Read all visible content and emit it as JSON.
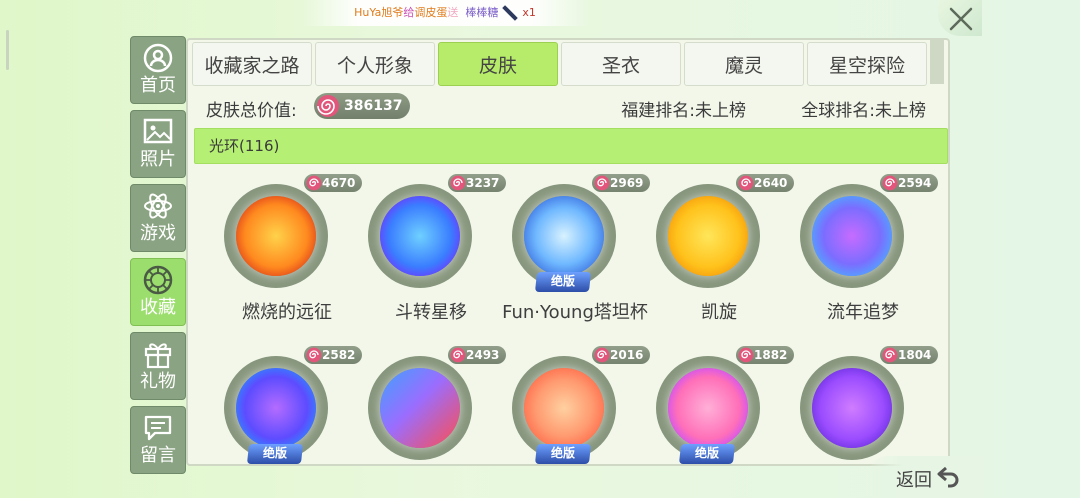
{
  "notice": {
    "part1": "HuYa旭爷",
    "part2": "给",
    "part3": "调皮蛋",
    "part4": "送",
    "part5": "棒棒糖",
    "count": "x1"
  },
  "sidebar": {
    "items": [
      {
        "label": "首页",
        "icon": "user-icon"
      },
      {
        "label": "照片",
        "icon": "photo-icon"
      },
      {
        "label": "游戏",
        "icon": "atom-icon"
      },
      {
        "label": "收藏",
        "icon": "collection-icon"
      },
      {
        "label": "礼物",
        "icon": "gift-icon"
      },
      {
        "label": "留言",
        "icon": "message-icon"
      }
    ],
    "active_index": 3
  },
  "tabs": [
    "收藏家之路",
    "个人形象",
    "皮肤",
    "圣衣",
    "魔灵",
    "星空探险"
  ],
  "active_tab": "皮肤",
  "value_row": {
    "label": "皮肤总价值:",
    "value": "386137",
    "rank_province": "福建排名:未上榜",
    "rank_global": "全球排名:未上榜"
  },
  "section": {
    "title": "光环(116)"
  },
  "items": [
    {
      "name": "燃烧的远征",
      "price": "4670",
      "limited": false
    },
    {
      "name": "斗转星移",
      "price": "3237",
      "limited": false
    },
    {
      "name": "Fun·Young塔坦杯",
      "price": "2969",
      "limited": true
    },
    {
      "name": "凯旋",
      "price": "2640",
      "limited": false
    },
    {
      "name": "流年追梦",
      "price": "2594",
      "limited": false
    },
    {
      "name": "",
      "price": "2582",
      "limited": true
    },
    {
      "name": "",
      "price": "2493",
      "limited": false
    },
    {
      "name": "",
      "price": "2016",
      "limited": true
    },
    {
      "name": "",
      "price": "1882",
      "limited": true
    },
    {
      "name": "",
      "price": "1804",
      "limited": false
    }
  ],
  "limited_label": "绝版",
  "back_label": "返回",
  "colors": {
    "accent": "#b7ec6a",
    "nav": "#8aa382",
    "nav_active": "#9cde6e",
    "candy": "#e2567c"
  }
}
